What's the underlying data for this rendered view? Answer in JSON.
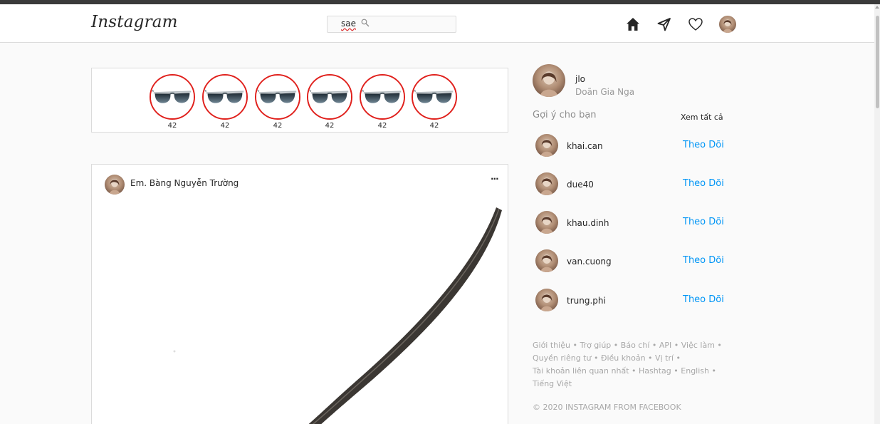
{
  "header": {
    "logo": "Instagram",
    "search_value": "sae"
  },
  "stories": [
    {
      "label": "42"
    },
    {
      "label": "42"
    },
    {
      "label": "42"
    },
    {
      "label": "42"
    },
    {
      "label": "42"
    },
    {
      "label": "42"
    }
  ],
  "post": {
    "username": "Em. Bàng Nguyễn Trường",
    "more": "···"
  },
  "sidebar": {
    "username": "jlo",
    "fullname": "Doãn Gia Nga",
    "suggest_title": "Gợi ý cho bạn",
    "see_all": "Xem tất cả",
    "suggestions": [
      {
        "name": "khai.can",
        "follow": "Theo Dõi"
      },
      {
        "name": "due40",
        "follow": "Theo Dõi"
      },
      {
        "name": "khau.dinh",
        "follow": "Theo Dõi"
      },
      {
        "name": "van.cuong",
        "follow": "Theo Dõi"
      },
      {
        "name": "trung.phi",
        "follow": "Theo Dõi"
      }
    ],
    "footer_links": [
      "Giới thiệu",
      "Trợ giúp",
      "Báo chí",
      "API",
      "Việc làm",
      "Quyền riêng tư",
      "Điều khoản",
      "Vị trí",
      "Tài khoản liên quan nhất",
      "Hashtag",
      "English",
      "Tiếng Việt"
    ],
    "footer_separator": " • ",
    "copyright": "© 2020 INSTAGRAM FROM FACEBOOK"
  },
  "colors": {
    "story_ring": "#e0201c",
    "follow_link": "#0095f6"
  }
}
